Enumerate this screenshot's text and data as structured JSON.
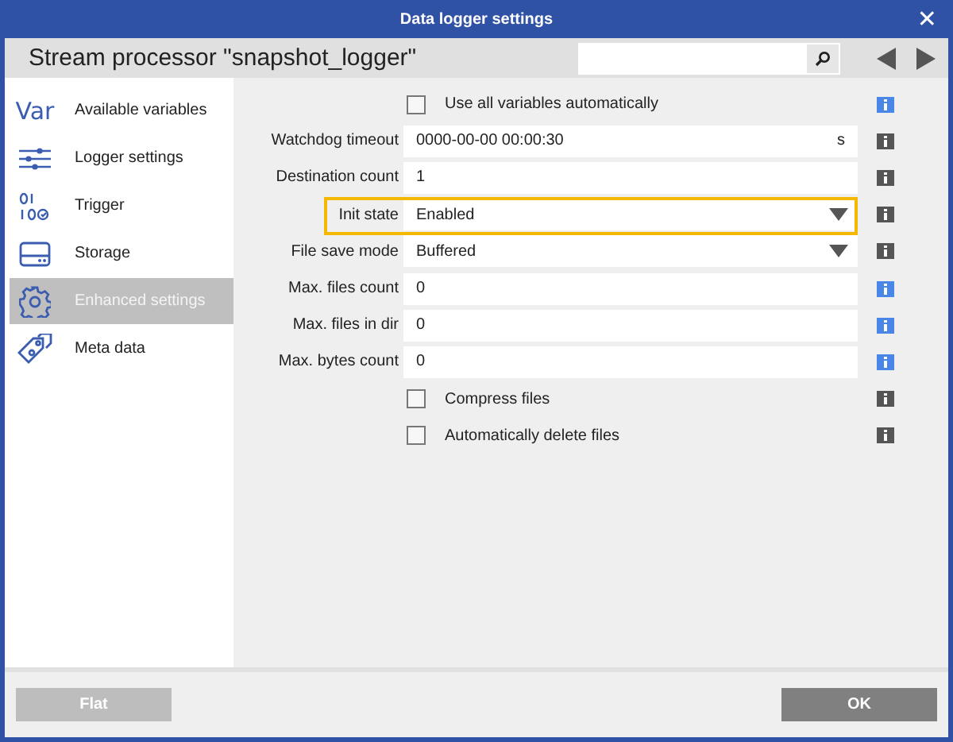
{
  "window": {
    "title": "Data logger settings",
    "close": "✕"
  },
  "header": {
    "title": "Stream processor \"snapshot_logger\""
  },
  "sidebar": {
    "items": [
      {
        "label": "Available variables",
        "icon_text": "Var",
        "selected": false
      },
      {
        "label": "Logger settings",
        "selected": false
      },
      {
        "label": "Trigger",
        "selected": false
      },
      {
        "label": "Storage",
        "selected": false
      },
      {
        "label": "Enhanced settings",
        "selected": true
      },
      {
        "label": "Meta data",
        "selected": false
      }
    ]
  },
  "rows": [
    {
      "kind": "checkbox",
      "label": "Use all variables automatically",
      "checked": false,
      "color": "#4a86e8"
    },
    {
      "kind": "text",
      "label": "Watchdog timeout",
      "value": "0000-00-00 00:00:30",
      "unit": "s",
      "color": "#555555"
    },
    {
      "kind": "text",
      "label": "Destination count",
      "value": "1",
      "color": "#555555"
    },
    {
      "kind": "select",
      "label": "Init state",
      "value": "Enabled",
      "highlighted": true,
      "color": "#555555"
    },
    {
      "kind": "select",
      "label": "File save mode",
      "value": "Buffered",
      "color": "#555555"
    },
    {
      "kind": "text",
      "label": "Max. files count",
      "value": "0",
      "color": "#4a86e8"
    },
    {
      "kind": "text",
      "label": "Max. files in dir",
      "value": "0",
      "color": "#4a86e8"
    },
    {
      "kind": "text",
      "label": "Max. bytes count",
      "value": "0",
      "color": "#4a86e8"
    },
    {
      "kind": "checkbox",
      "label": "Compress files",
      "checked": false,
      "color": "#555555"
    },
    {
      "kind": "checkbox",
      "label": "Automatically delete files",
      "checked": false,
      "color": "#555555"
    }
  ],
  "footer": {
    "buttons": [
      {
        "label": "Flat",
        "disabled": true
      },
      {
        "label": "OK",
        "disabled": false
      }
    ]
  }
}
